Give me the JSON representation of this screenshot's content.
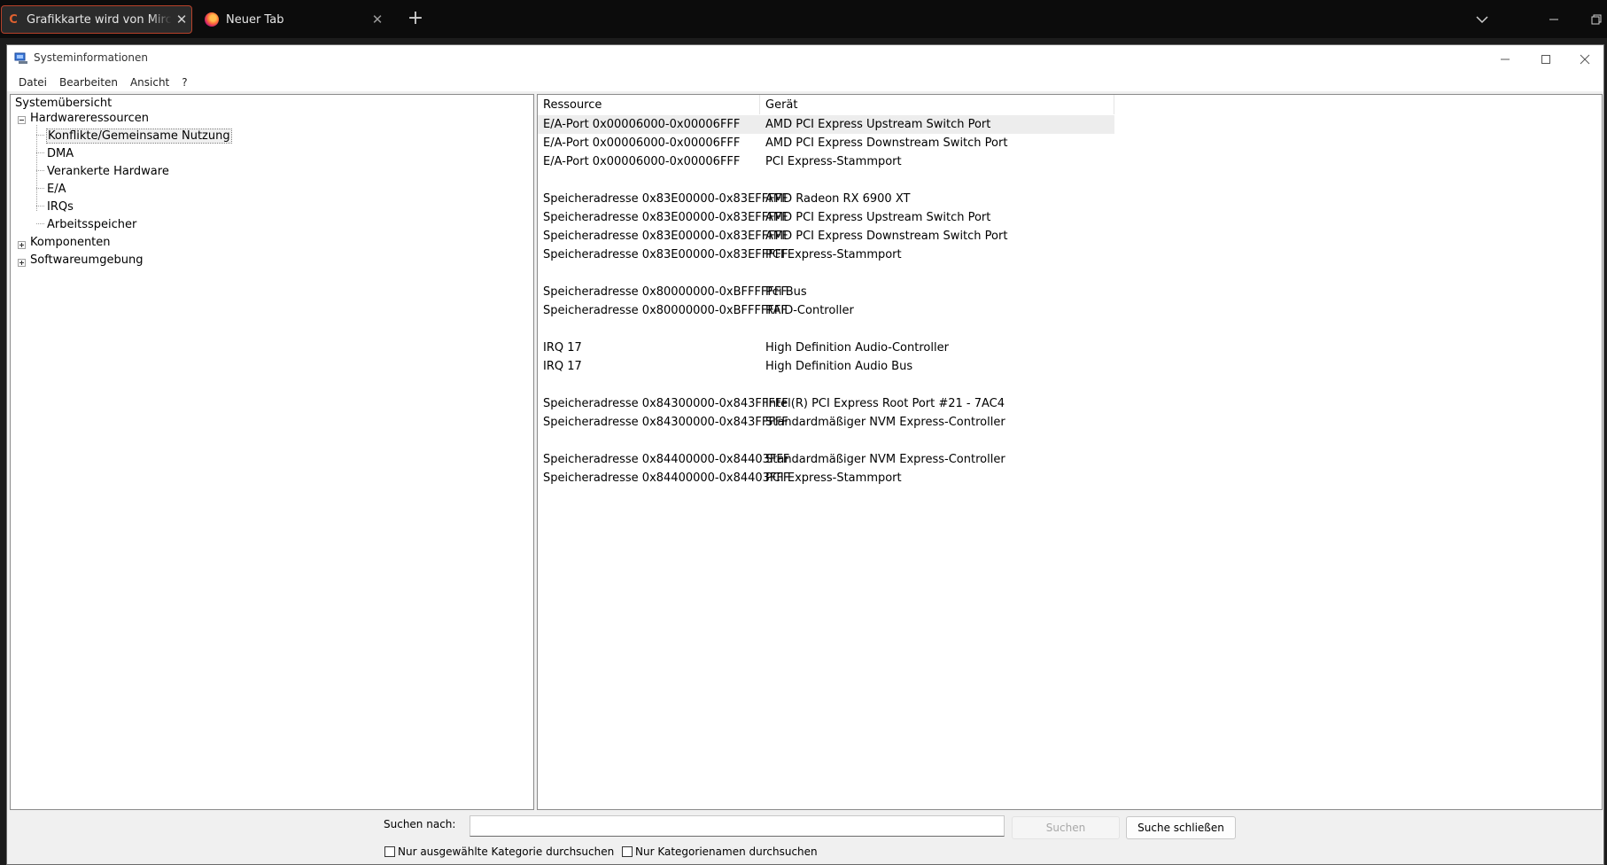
{
  "browser": {
    "tabs": [
      {
        "title": "Grafikkarte wird von Mircosoft als",
        "active": true,
        "close": "✕"
      },
      {
        "title": "Neuer Tab",
        "active": false,
        "close": "✕"
      }
    ],
    "new_tab": "+",
    "accent": "#b7412a"
  },
  "window": {
    "title": "Systeminformationen"
  },
  "menu": [
    "Datei",
    "Bearbeiten",
    "Ansicht",
    "?"
  ],
  "tree": {
    "root": "Systemübersicht",
    "hardware": "Hardwareressourcen",
    "children": [
      "Konflikte/Gemeinsame Nutzung",
      "DMA",
      "Verankerte Hardware",
      "E/A",
      "IRQs",
      "Arbeitsspeicher"
    ],
    "components": "Komponenten",
    "software": "Softwareumgebung",
    "selected": "Konflikte/Gemeinsame Nutzung"
  },
  "table": {
    "columns": [
      "Ressource",
      "Gerät"
    ],
    "rows": [
      [
        "E/A-Port 0x00006000-0x00006FFF",
        "AMD PCI Express Upstream Switch Port"
      ],
      [
        "E/A-Port 0x00006000-0x00006FFF",
        "AMD PCI Express Downstream Switch Port"
      ],
      [
        "E/A-Port 0x00006000-0x00006FFF",
        "PCI Express-Stammport"
      ],
      [
        "",
        ""
      ],
      [
        "Speicheradresse 0x83E00000-0x83EFFFFF",
        "AMD Radeon RX 6900 XT"
      ],
      [
        "Speicheradresse 0x83E00000-0x83EFFFFF",
        "AMD PCI Express Upstream Switch Port"
      ],
      [
        "Speicheradresse 0x83E00000-0x83EFFFFF",
        "AMD PCI Express Downstream Switch Port"
      ],
      [
        "Speicheradresse 0x83E00000-0x83EFFFFF",
        "PCI Express-Stammport"
      ],
      [
        "",
        ""
      ],
      [
        "Speicheradresse 0x80000000-0xBFFFFFFF",
        "Pci Bus"
      ],
      [
        "Speicheradresse 0x80000000-0xBFFFFFFF",
        "RAID-Controller"
      ],
      [
        "",
        ""
      ],
      [
        "IRQ 17",
        "High Definition Audio-Controller"
      ],
      [
        "IRQ 17",
        "High Definition Audio Bus"
      ],
      [
        "",
        ""
      ],
      [
        "Speicheradresse 0x84300000-0x843FFFFF",
        "Intel(R) PCI Express Root Port #21 - 7AC4"
      ],
      [
        "Speicheradresse 0x84300000-0x843FFFFF",
        "Standardmäßiger NVM Express-Controller"
      ],
      [
        "",
        ""
      ],
      [
        "Speicheradresse 0x84400000-0x84403FFF",
        "Standardmäßiger NVM Express-Controller"
      ],
      [
        "Speicheradresse 0x84400000-0x84403FFF",
        "PCI Express-Stammport"
      ]
    ]
  },
  "search": {
    "label": "Suchen nach:",
    "value": "",
    "search_button": "Suchen",
    "close_button": "Suche schließen",
    "checkbox_selected_category": "Nur ausgewählte Kategorie durchsuchen",
    "checkbox_category_names": "Nur Kategorienamen durchsuchen"
  }
}
